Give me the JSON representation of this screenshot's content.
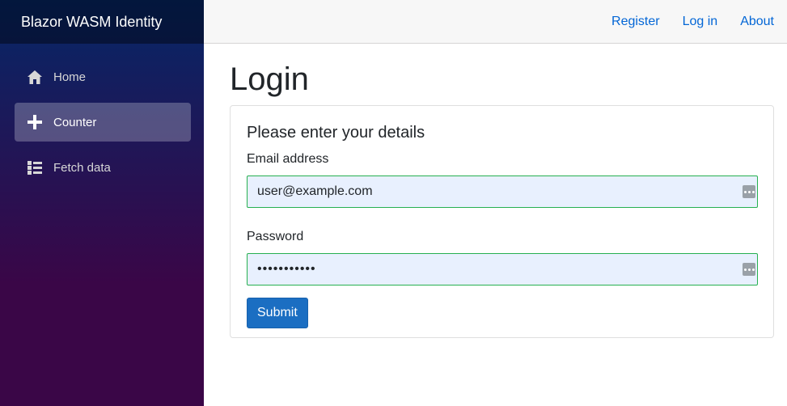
{
  "brand": "Blazor WASM Identity",
  "nav": {
    "items": [
      {
        "label": "Home",
        "icon": "home-icon",
        "active": false
      },
      {
        "label": "Counter",
        "icon": "plus-icon",
        "active": true
      },
      {
        "label": "Fetch data",
        "icon": "list-icon",
        "active": false
      }
    ]
  },
  "top_links": [
    "Register",
    "Log in",
    "About"
  ],
  "page": {
    "title": "Login",
    "card_title": "Please enter your details",
    "email_label": "Email address",
    "email_value": "user@example.com",
    "password_label": "Password",
    "password_value": "•••••••••••",
    "submit_label": "Submit"
  },
  "colors": {
    "link": "#0366d6",
    "primary_button": "#1b6ec2",
    "field_border": "#26b050",
    "field_background": "#e8f0fe",
    "sidebar_top": "#052767",
    "sidebar_bottom": "#3a0647"
  }
}
